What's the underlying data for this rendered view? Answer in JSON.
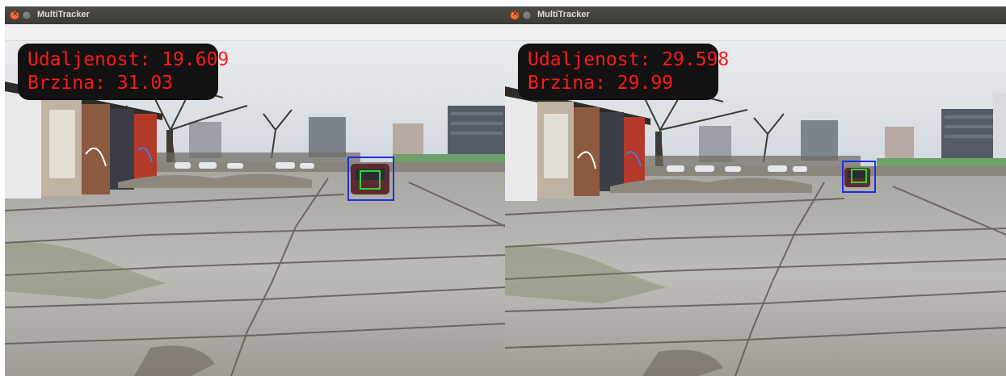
{
  "windows": [
    {
      "title": "MultiTracker",
      "overlay": {
        "distance_label": "Udaljenost:",
        "distance_value": "19.609",
        "speed_label": "Brzina:",
        "speed_value": "31.03"
      }
    },
    {
      "title": "MultiTracker",
      "overlay": {
        "distance_label": "Udaljenost:",
        "distance_value": "29.598",
        "speed_label": "Brzina:",
        "speed_value": "29.99"
      }
    }
  ],
  "icons": {
    "close": "close-icon",
    "minimize": "minimize-icon"
  },
  "colors": {
    "overlay_text": "#ff1a1a",
    "tracker_outer": "#1f2fe6",
    "tracker_inner": "#2cd82c",
    "titlebar": "#3f3e3a"
  }
}
